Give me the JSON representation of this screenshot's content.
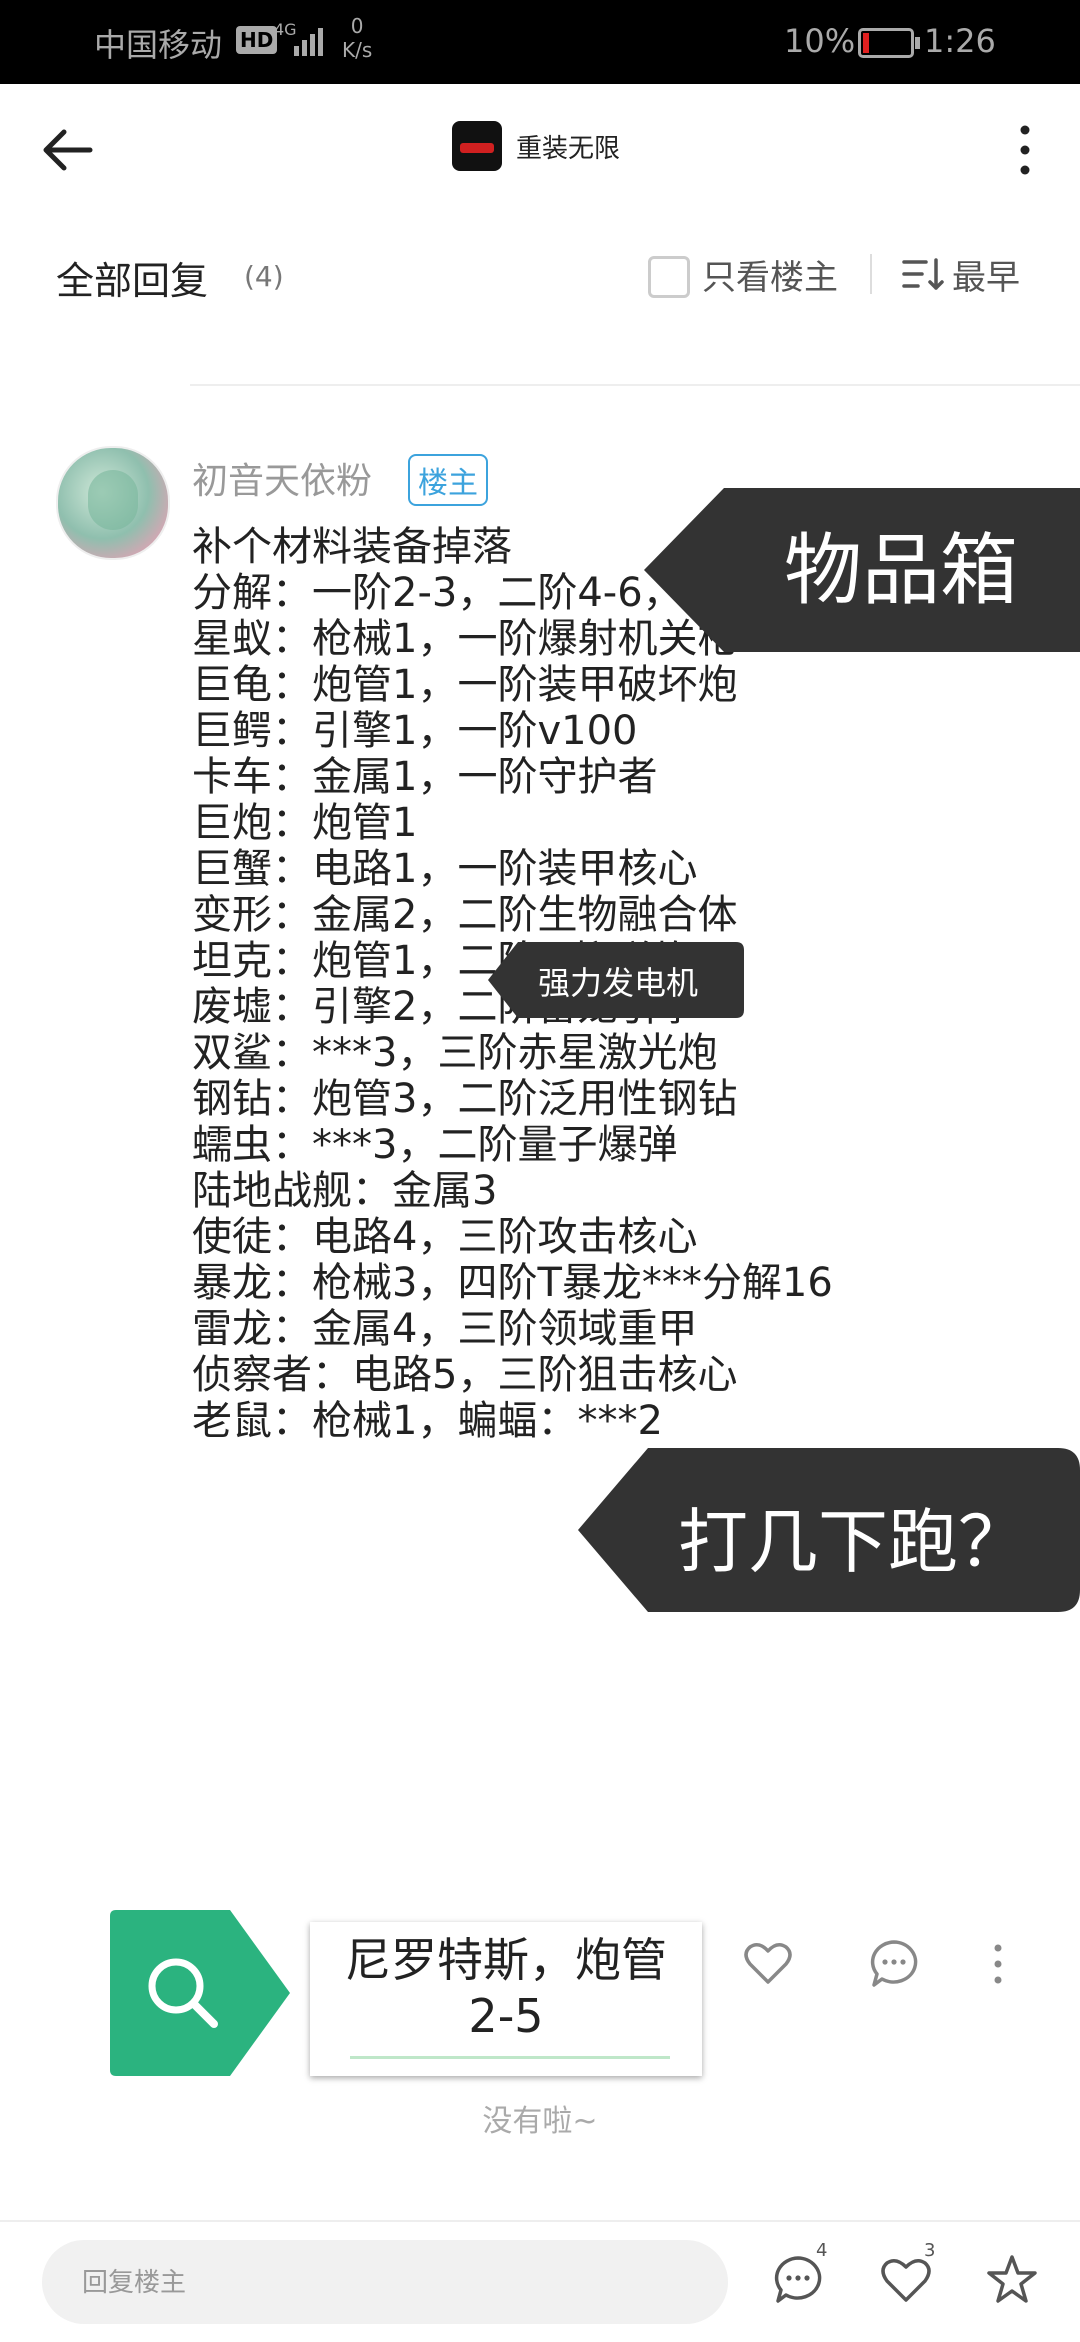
{
  "status_bar": {
    "carrier": "中国移动",
    "hd": "HD",
    "network": "4G",
    "speed_value": "0",
    "speed_unit": "K/s",
    "battery": "10%",
    "time": "1:26"
  },
  "header": {
    "app_name": "重装无限",
    "tab_title": "全部回复",
    "reply_count": "(4)",
    "only_op_label": "只看楼主",
    "sort_label": "最早"
  },
  "post": {
    "username": "初音天依粉",
    "op_badge": "楼主",
    "lines": [
      "补个材料装备掉落",
      "分解：一阶2-3，二阶4-6，三阶7-9",
      "星蚁：枪械1，一阶爆射机关枪",
      "巨龟：炮管1，一阶装甲破坏炮",
      "巨鳄：引擎1，一阶v100",
      "卡车：金属1，一阶守护者",
      "巨炮：炮管1",
      "巨蟹：电路1，一阶装甲核心",
      "变形：金属2，二阶生物融合体",
      "坦克：炮管1，二阶T-榴弹炮",
      "废墟：引擎2，二阶雷龙引擎",
      "双鲨：***3，三阶赤星激光炮",
      "钢钻：炮管3，二阶泛用性钢钻",
      "蠕虫：***3，二阶量子爆弹",
      "陆地战舰：金属3",
      "使徒：电路4，三阶攻击核心",
      "暴龙：枪械3，四阶T暴龙***分解16",
      "雷龙：金属4，三阶领域重甲",
      "侦察者：电路5，三阶狙击核心",
      "老鼠：枪械1，蝙蝠：***2"
    ]
  },
  "overlays": {
    "big_banner": "物品箱",
    "tooltip": "强力发电机",
    "run_banner": "打几下跑？",
    "search_card_line1": "尼罗特斯，炮管",
    "search_card_line2": "2-5"
  },
  "footer": {
    "no_more": "没有啦~",
    "reply_placeholder": "回复楼主",
    "comment_count": "4",
    "like_count": "3"
  },
  "colors": {
    "accent_blue": "#3ca3dd",
    "banner_dark": "#333333",
    "search_green": "#2bb37f"
  }
}
